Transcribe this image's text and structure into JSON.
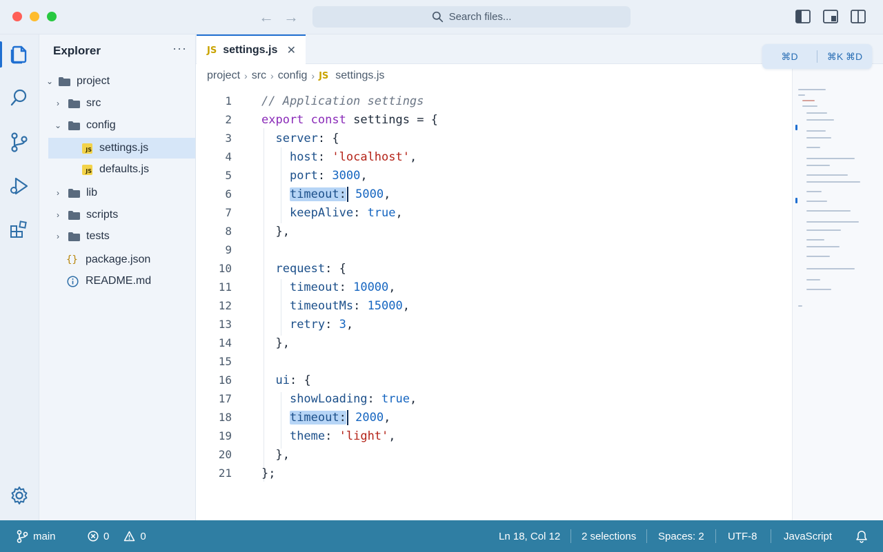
{
  "titlebar": {
    "search_placeholder": "Search files...",
    "back_icon": "arrow-left-icon",
    "forward_icon": "arrow-right-icon"
  },
  "sidebar": {
    "title": "Explorer",
    "more": "···",
    "tree": [
      {
        "label": "project",
        "type": "folder",
        "expanded": true
      },
      {
        "label": "src",
        "type": "folder",
        "expanded": false
      },
      {
        "label": "config",
        "type": "folder",
        "expanded": true
      },
      {
        "label": "settings.js",
        "type": "js",
        "selected": true
      },
      {
        "label": "defaults.js",
        "type": "js"
      },
      {
        "label": "lib",
        "type": "folder",
        "expanded": false
      },
      {
        "label": "scripts",
        "type": "folder",
        "expanded": false
      },
      {
        "label": "tests",
        "type": "folder",
        "expanded": false
      },
      {
        "label": "package.json",
        "type": "json"
      },
      {
        "label": "README.md",
        "type": "info"
      }
    ]
  },
  "editor": {
    "tab": {
      "label": "settings.js",
      "icon": "JS",
      "close": "✕"
    },
    "shortcuts": [
      "⌘D",
      "⌘K ⌘D"
    ],
    "breadcrumb": [
      "project",
      "src",
      "config",
      "settings.js"
    ],
    "line_numbers": [
      "1",
      "2",
      "3",
      "4",
      "5",
      "6",
      "7",
      "8",
      "9",
      "10",
      "11",
      "12",
      "13",
      "14",
      "15",
      "16",
      "17",
      "18",
      "19",
      "20",
      "21"
    ]
  },
  "statusbar": {
    "branch": "main",
    "errors": "0",
    "warnings": "0",
    "position": "Ln 18, Col 12",
    "selections": "2 selections",
    "indent": "Spaces: 2",
    "encoding": "UTF-8",
    "language": "JavaScript"
  },
  "colors": {
    "accent": "#1f6fd1",
    "statusbar": "#2f7ea3",
    "selection": "#b7d5f6"
  }
}
